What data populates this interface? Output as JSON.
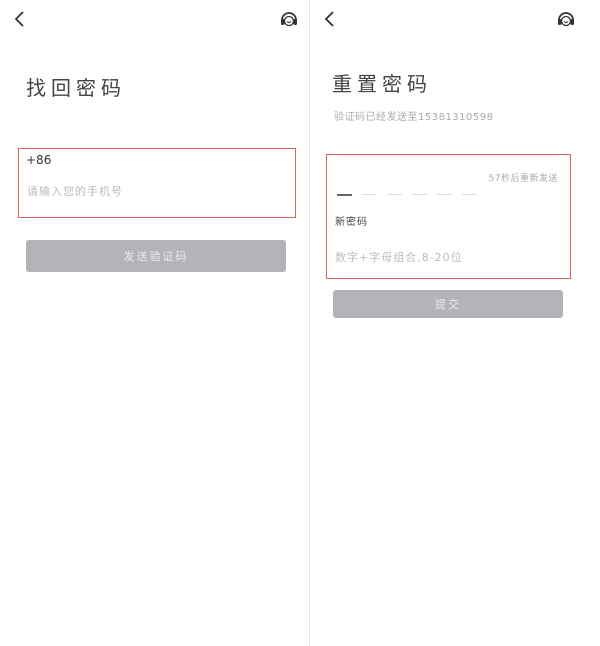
{
  "left": {
    "title": "找回密码",
    "country_code": "+86",
    "phone_placeholder": "请输入您的手机号",
    "send_code_label": "发送验证码",
    "icons": {
      "back": "chevron-left-icon",
      "service": "headset-icon"
    }
  },
  "right": {
    "title": "重置密码",
    "subtitle": "验证码已经发送至15381310598",
    "countdown": "57秒后重新发送",
    "code_length": 6,
    "new_password_label": "新密码",
    "password_placeholder": "数字+字母组合,8-20位",
    "submit_label": "提交",
    "icons": {
      "back": "chevron-left-icon",
      "service": "headset-icon"
    }
  },
  "colors": {
    "highlight_border": "#e06060",
    "button_disabled": "#b3b3b8",
    "button_text": "#ececec"
  }
}
